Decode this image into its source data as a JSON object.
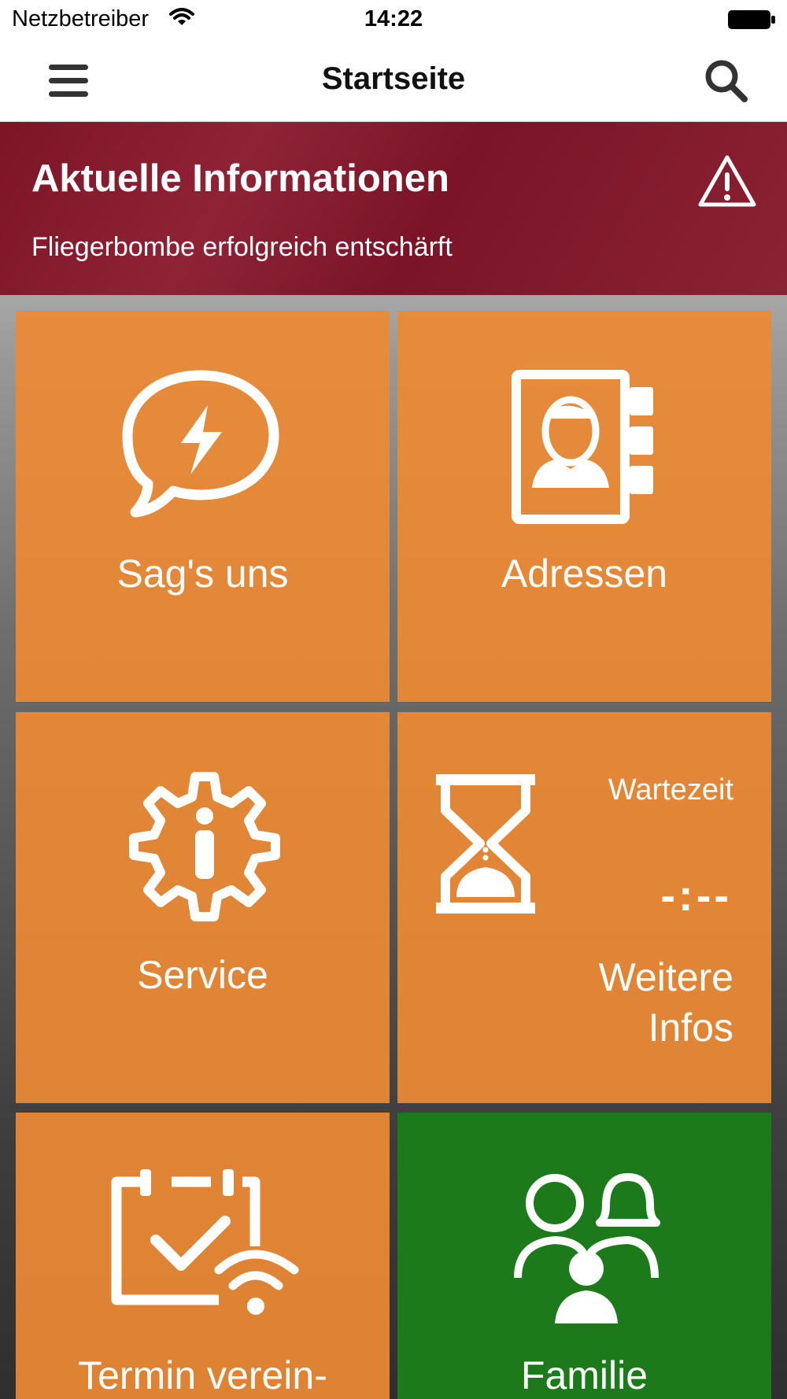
{
  "status_bar": {
    "carrier": "Netzbetreiber",
    "time": "14:22",
    "icons": [
      "wifi-icon",
      "battery-icon"
    ]
  },
  "nav": {
    "title": "Startseite",
    "icons": [
      "hamburger-menu-icon",
      "search-icon"
    ]
  },
  "alert": {
    "title": "Aktuelle Informationen",
    "text": "Fliegerbombe erfolgreich entschärft",
    "icon": "warning-triangle-icon"
  },
  "tiles": [
    {
      "label": "Sag's uns",
      "icon": "speech-bubble-lightning-icon",
      "color": "#EC8934"
    },
    {
      "label": "Adressen",
      "icon": "address-book-icon",
      "color": "#EC8934"
    },
    {
      "label": "Service",
      "icon": "gear-person-icon",
      "color": "#EC8934"
    },
    {
      "wait_label": "Wartezeit",
      "wait_value": "-:--",
      "label_line1": "Weitere",
      "label_line2": "Infos",
      "icon": "hourglass-icon",
      "color": "#EC8934"
    },
    {
      "label": "Termin verein-",
      "icon": "calendar-check-wifi-icon",
      "color": "#EC8934"
    },
    {
      "label": "Familie",
      "icon": "family-icon",
      "color": "#1C7A1A"
    }
  ]
}
